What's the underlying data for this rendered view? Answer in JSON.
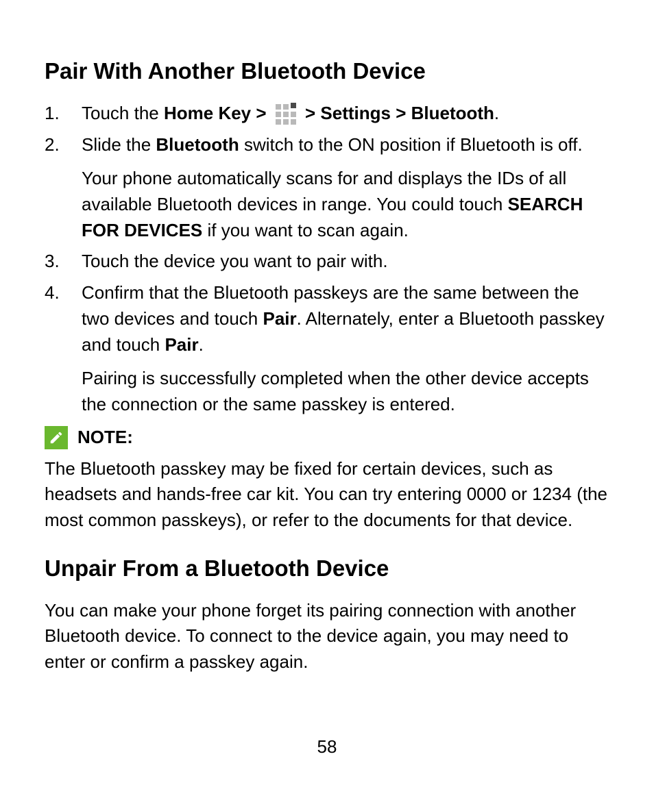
{
  "section1": {
    "heading": "Pair With Another Bluetooth Device",
    "steps": {
      "s1": {
        "pre": "Touch the ",
        "bold1": "Home Key > ",
        "bold2": " > Settings > Bluetooth",
        "post": "."
      },
      "s2": {
        "t1": "Slide the ",
        "b1": "Bluetooth",
        "t2": " switch to the ON position if Bluetooth is off.",
        "sub_t1": "Your phone automatically scans for and displays the IDs of all available Bluetooth devices in range. You could touch ",
        "sub_b1": "SEARCH FOR DEVICES",
        "sub_t2": " if you want to scan again."
      },
      "s3": "Touch the device you want to pair with.",
      "s4": {
        "t1": "Confirm that the Bluetooth passkeys are the same between the two devices and touch ",
        "b1": "Pair",
        "t2": ". Alternately, enter a Bluetooth passkey and touch ",
        "b2": "Pair",
        "t3": ".",
        "sub": "Pairing is successfully completed when the other device accepts the connection or the same passkey is entered."
      }
    },
    "note_label": "NOTE:",
    "note_body": "The Bluetooth passkey may be fixed for certain devices, such as headsets and hands-free car kit. You can try entering 0000 or 1234 (the most common passkeys), or refer to the documents for that device."
  },
  "section2": {
    "heading": "Unpair From a Bluetooth Device",
    "body": "You can make your phone forget its pairing connection with another Bluetooth device. To connect to the device again, you may need to enter or confirm a passkey again."
  },
  "page_number": "58"
}
